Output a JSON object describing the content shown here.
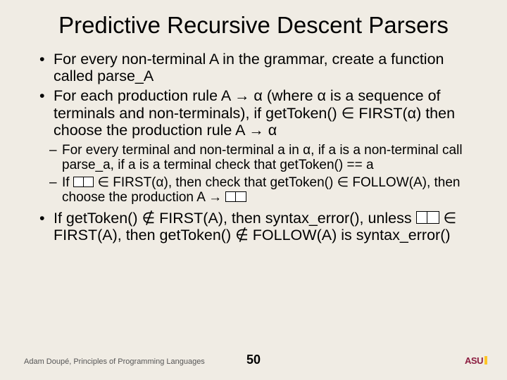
{
  "title": "Predictive Recursive Descent Parsers",
  "bullets": {
    "b1": "For every non-terminal A in the grammar, create a function called parse_A",
    "b2": "For each production rule A → α (where α is a sequence of terminals and non-terminals), if getToken() ∈ FIRST(α) then choose the production rule A → α",
    "s1": "For every terminal and non-terminal a in α, if a is a non-terminal call parse_a, if a is a terminal check that getToken() == a",
    "s2a": "If ",
    "s2b": " ∈ FIRST(α), then check that getToken() ∈ FOLLOW(A), then choose the production A → ",
    "b3a": "If getToken() ∉ FIRST(A), then syntax_error(), unless ",
    "b3b": " ∈ FIRST(A), then getToken() ∉ FOLLOW(A) is syntax_error()"
  },
  "footer": {
    "author": "Adam Doupé, Principles of Programming Languages",
    "page": "50",
    "logo": "ASU"
  }
}
